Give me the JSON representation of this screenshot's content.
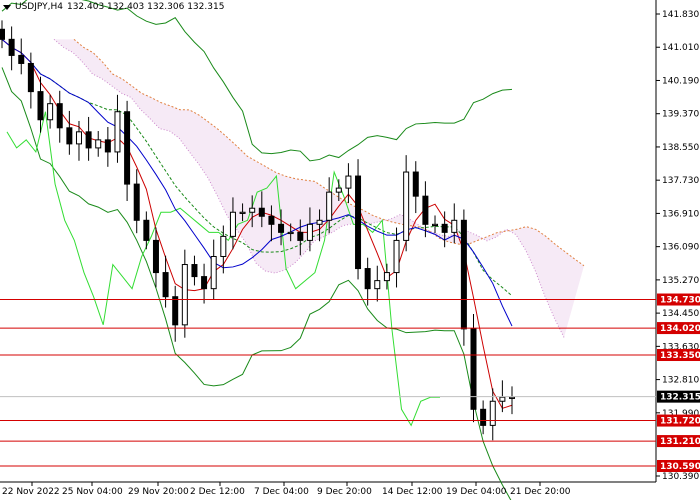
{
  "header": {
    "symbol": "USDJPY,H4",
    "ohlc": "132.403 132.403 132.306 132.315"
  },
  "colors": {
    "level_line": "#d40000",
    "level_tag_bg": "#d40000",
    "current_tag_bg": "#000000",
    "bollinger": "#1a8a1a",
    "chikou": "#33dd33",
    "tenkan": "#cc0000",
    "kijun": "#0000cc",
    "cloud": "#cc88cc",
    "cloud_edge": "#e08040",
    "candle": "#000000"
  },
  "price_axis": {
    "labels": [
      "141.830",
      "141.010",
      "140.190",
      "139.370",
      "138.550",
      "137.730",
      "136.910",
      "136.090",
      "135.270",
      "134.450",
      "133.630",
      "132.810",
      "131.990",
      "130.390"
    ]
  },
  "time_axis": {
    "labels": [
      "22 Nov 2022",
      "25 Nov 04:00",
      "29 Nov 20:00",
      "2 Dec 12:00",
      "7 Dec 04:00",
      "9 Dec 20:00",
      "14 Dec 12:00",
      "19 Dec 04:00",
      "21 Dec 20:00"
    ]
  },
  "levels": [
    {
      "label": "134.730",
      "price": 134.73
    },
    {
      "label": "134.020",
      "price": 134.02
    },
    {
      "label": "133.350",
      "price": 133.35
    },
    {
      "label": "131.720",
      "price": 131.72
    },
    {
      "label": "131.210",
      "price": 131.21
    },
    {
      "label": "130.590",
      "price": 130.59
    }
  ],
  "current_price": {
    "label": "132.315",
    "price": 132.315
  },
  "chart_data": {
    "type": "candlestick",
    "symbol": "USDJPY",
    "timeframe": "H4",
    "ylim": [
      130.3,
      142.1
    ],
    "x": [
      "22 Nov 2022",
      "25 Nov 04:00",
      "29 Nov 20:00",
      "2 Dec 12:00",
      "7 Dec 04:00",
      "9 Dec 20:00",
      "14 Dec 12:00",
      "19 Dec 04:00",
      "21 Dec 20:00"
    ],
    "close_path": [
      141.2,
      140.8,
      140.6,
      139.9,
      139.2,
      139.6,
      139.0,
      138.6,
      138.9,
      138.5,
      138.7,
      138.4,
      139.4,
      137.6,
      136.7,
      136.2,
      135.4,
      134.8,
      134.1,
      135.6,
      135.3,
      135.0,
      135.8,
      136.3,
      136.9,
      136.9,
      137.0,
      136.8,
      136.6,
      136.4,
      136.4,
      136.2,
      136.6,
      136.7,
      137.4,
      137.5,
      137.8,
      135.5,
      135.0,
      135.2,
      135.4,
      136.2,
      137.9,
      137.3,
      136.6,
      136.6,
      136.4,
      136.7,
      134.0,
      132.0,
      131.6,
      132.2,
      132.3,
      132.3
    ]
  }
}
